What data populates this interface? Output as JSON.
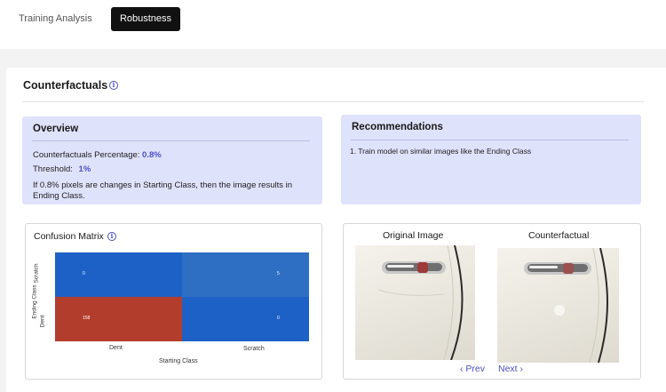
{
  "tabs": {
    "training_analysis": "Training Analysis",
    "robustness": "Robustness"
  },
  "section": {
    "title": "Counterfactuals"
  },
  "overview": {
    "title": "Overview",
    "percentage_label": "Counterfactuals Percentage:",
    "percentage_value": "0.8%",
    "threshold_label": "Threshold:",
    "threshold_value": "1%",
    "description": "If 0.8% pixels are changes in Starting Class, then the image results in Ending Class."
  },
  "recommendations": {
    "title": "Recommendations",
    "items": [
      "1. Train model on similar images like the Ending Class"
    ]
  },
  "confusion_matrix": {
    "title": "Confusion Matrix",
    "colors": {
      "high": "#b33d2c",
      "mid": "#2e6fc4",
      "low": "#1e61c6"
    }
  },
  "chart_data": {
    "type": "heatmap",
    "title": "Confusion Matrix",
    "xlabel": "Starting Class",
    "ylabel": "Ending Class",
    "x_categories": [
      "Dent",
      "Scratch"
    ],
    "y_categories": [
      "Scratch",
      "Dent"
    ],
    "values": [
      [
        0,
        5
      ],
      [
        158,
        0
      ]
    ],
    "value_labels": [
      [
        "0",
        "5"
      ],
      [
        "158",
        "0"
      ]
    ]
  },
  "counterfactual_viewer": {
    "original_label": "Original Image",
    "counterfactual_label": "Counterfactual",
    "prev_label": "Prev",
    "next_label": "Next",
    "prev_icon": "chevron-left-icon",
    "next_icon": "chevron-right-icon"
  },
  "accent_color": "#4b50c8"
}
